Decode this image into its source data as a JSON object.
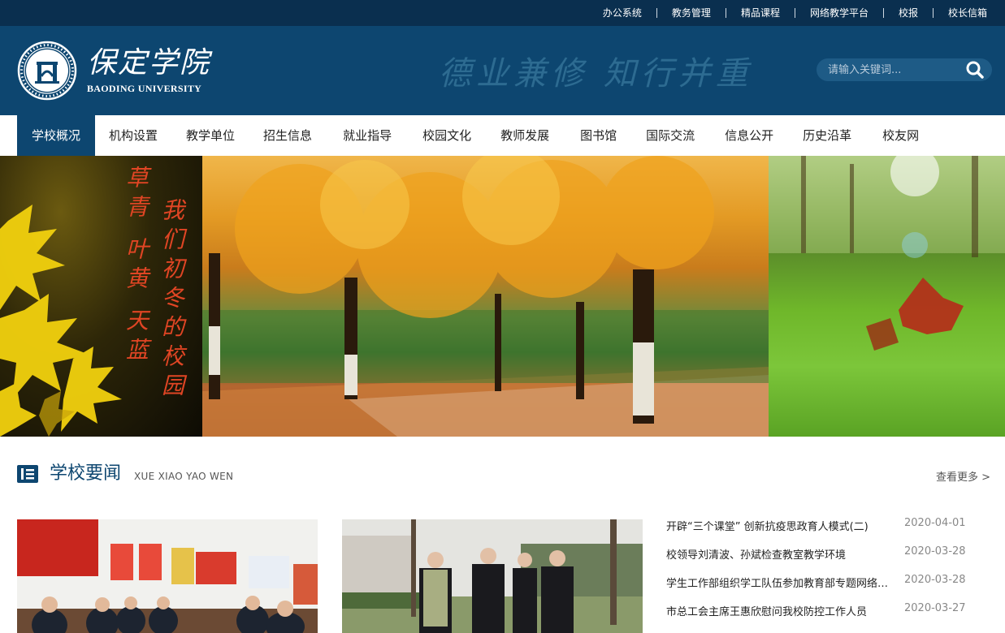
{
  "top_links": [
    "办公系统",
    "教务管理",
    "精品课程",
    "网络教学平台",
    "校报",
    "校长信箱"
  ],
  "header": {
    "logo_cn": "保定学院",
    "logo_en": "BAODING UNIVERSITY",
    "motto": "德业兼修 知行并重",
    "search_placeholder": "请输入关键词..."
  },
  "nav": [
    "学校概况",
    "机构设置",
    "教学单位",
    "招生信息",
    "就业指导",
    "校园文化",
    "教师发展",
    "图书馆",
    "国际交流",
    "信息公开",
    "历史沿革",
    "校友网"
  ],
  "nav_active": 0,
  "banner": {
    "poem_col1": "草青",
    "poem_col2": "叶黄",
    "poem_col3": "天蓝",
    "poem_col4": "我们",
    "poem_col5": "初冬的校园"
  },
  "news": {
    "title": "学校要闻",
    "pinyin": "XUE XIAO YAO WEN",
    "more": "查看更多 >",
    "items": [
      {
        "title": "开辟“三个课堂” 创新抗疫思政育人模式(二)",
        "date": "2020-04-01"
      },
      {
        "title": "校领导刘清波、孙斌检查教室教学环境",
        "date": "2020-03-28"
      },
      {
        "title": "学生工作部组织学工队伍参加教育部专题网络培训",
        "date": "2020-03-28"
      },
      {
        "title": "市总工会主席王惠欣慰问我校防控工作人员",
        "date": "2020-03-27"
      }
    ]
  },
  "colors": {
    "topbar": "#0a2f4f",
    "header": "#0d4670",
    "accent": "#0d4670",
    "poem": "#e04524"
  }
}
